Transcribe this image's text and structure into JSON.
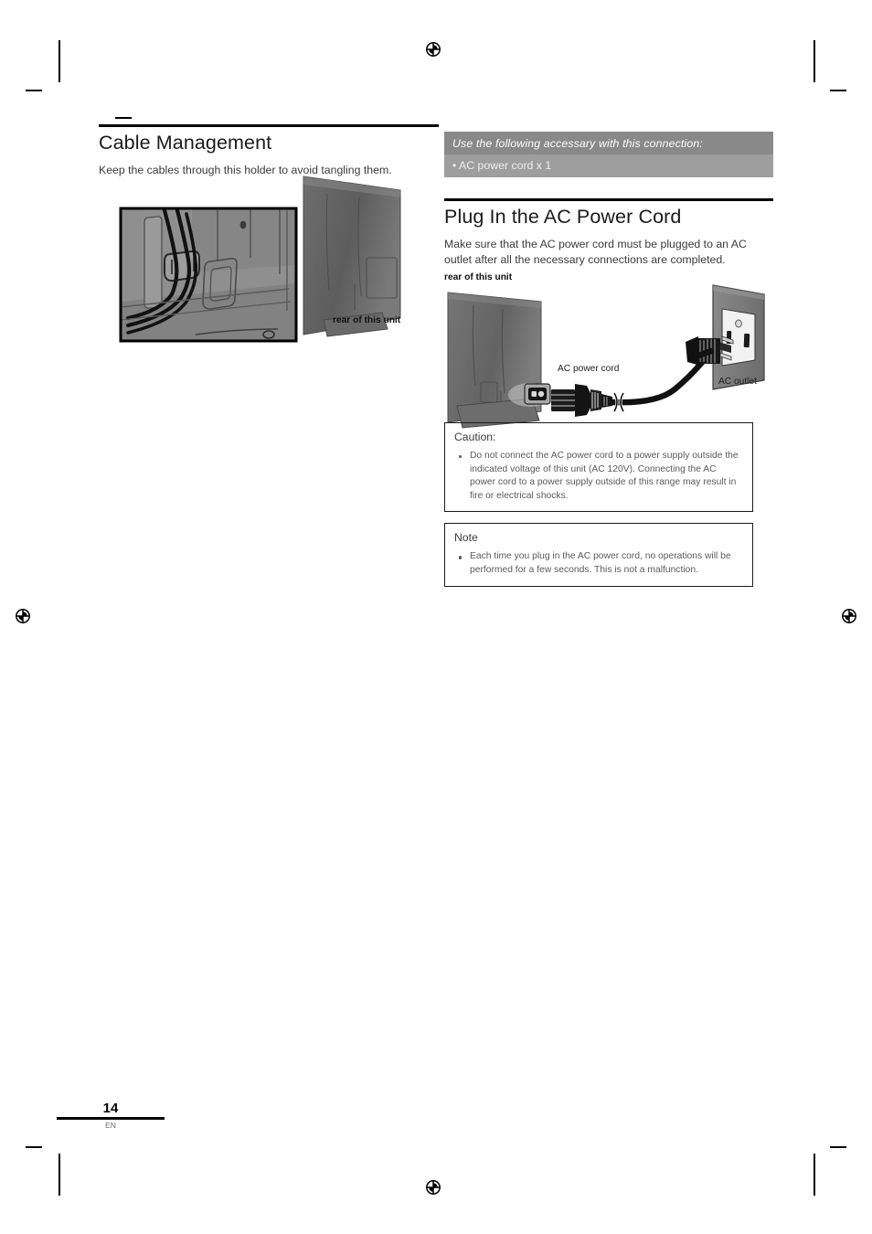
{
  "page": {
    "number": "14",
    "language_code": "EN"
  },
  "left_column": {
    "heading": "Cable Management",
    "intro": "Keep the cables through this holder to avoid tangling them.",
    "figure": {
      "name": "cable-management-illustration",
      "caption": "rear of this unit"
    }
  },
  "right_column": {
    "accessory_box": {
      "title": "Use the following accessary with this connection:",
      "items": [
        "• AC power cord x 1"
      ],
      "title_bg": "#898989",
      "body_bg": "#9e9e9e"
    },
    "heading": "Plug In the AC Power Cord",
    "intro": "Make sure that the AC power cord must be plugged to an AC outlet after all the necessary connections are completed.",
    "figure": {
      "name": "ac-power-cord-diagram",
      "label_unit": "rear of this unit",
      "label_cord": "AC power cord",
      "label_outlet": "AC outlet"
    },
    "caution_box": {
      "title": "Caution:",
      "items": [
        "Do not connect the AC power cord to a power supply outside the indicated voltage of this unit (AC 120V). Connecting the AC power cord to a power supply outside of this range may result in fire or electrical shocks."
      ]
    },
    "note_box": {
      "title": "Note",
      "items": [
        "Each time you plug in the AC power cord, no operations will be performed for a few seconds. This is not a malfunction."
      ]
    }
  },
  "printer_marks": {
    "registration_icon": "registration-target-icon",
    "crop_mark": "crop-mark"
  }
}
